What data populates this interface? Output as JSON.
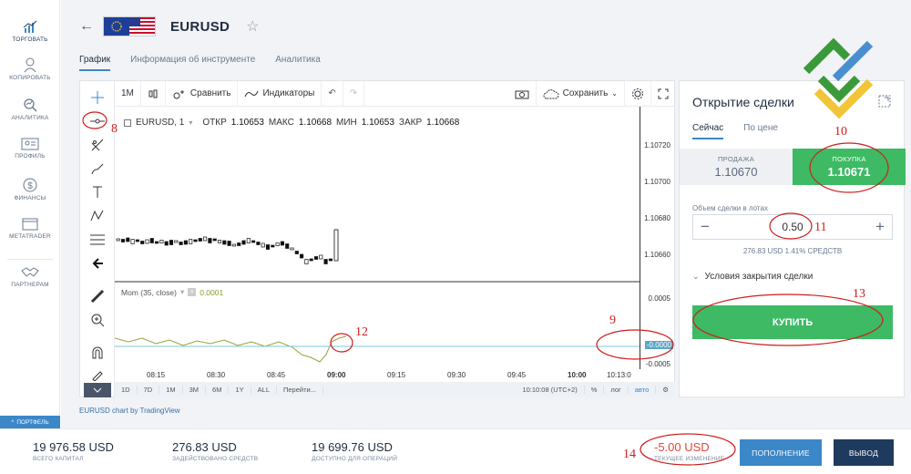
{
  "sidebar": {
    "items": [
      {
        "label": "ТОРГОВАТЬ",
        "icon": "chart-trade-icon"
      },
      {
        "label": "КОПИРОВАТЬ",
        "icon": "copy-user-icon"
      },
      {
        "label": "АНАЛИТИКА",
        "icon": "analytics-icon"
      },
      {
        "label": "ПРОФИЛЬ",
        "icon": "profile-card-icon"
      },
      {
        "label": "ФИНАНСЫ",
        "icon": "dollar-icon"
      },
      {
        "label": "METATRADER",
        "icon": "window-icon"
      },
      {
        "label": "ПАРТНЕРАМ",
        "icon": "handshake-icon"
      }
    ],
    "portfolio_tab": "ПОРТФЕЛЬ"
  },
  "header": {
    "symbol": "EURUSD",
    "tabs": [
      "График",
      "Информация об инструменте",
      "Аналитика"
    ]
  },
  "toolbar": {
    "interval": "1М",
    "compare": "Сравнить",
    "indicators": "Индикаторы",
    "save": "Сохранить"
  },
  "legend": {
    "symbol": "EURUSD, 1",
    "open_label": "ОТКР",
    "open": "1.10653",
    "high_label": "МАКС",
    "high": "1.10668",
    "low_label": "МИН",
    "low": "1.10653",
    "close_label": "ЗАКР",
    "close": "1.10668"
  },
  "price_axis": [
    "1.10720",
    "1.10700",
    "1.10680",
    "1.10660"
  ],
  "mom": {
    "label": "Mom (35, close)",
    "value": "0.0001",
    "axis_top": "0.0005",
    "axis_mid": "-0.0000",
    "axis_bottom": "-0.0005"
  },
  "time_axis": [
    "08:15",
    "08:30",
    "08:45",
    "09:00",
    "09:15",
    "09:30",
    "09:45",
    "10:00",
    "10:13:0"
  ],
  "bottom_bar": {
    "ranges": [
      "1D",
      "7D",
      "1М",
      "3М",
      "6М",
      "1Y",
      "ALL",
      "Перейти..."
    ],
    "clock": "10:10:08 (UTC+2)",
    "percent": "%",
    "log": "лог",
    "auto": "авто"
  },
  "credit": "EURUSD chart by TradingView",
  "order": {
    "title": "Открытие сделки",
    "tabs": [
      "Сейчас",
      "По цене"
    ],
    "sell_label": "ПРОДАЖА",
    "sell_price": "1.10670",
    "buy_label": "ПОКУПКА",
    "buy_price": "1.10671",
    "lot_label": "Объем сделки в лотах",
    "lot_value": "0.50",
    "minus": "−",
    "plus": "+",
    "lot_info": "276.83 USD   1.41% СРЕДСТВ",
    "conditions": "Условия закрытия сделки",
    "buy_button": "КУПИТЬ"
  },
  "footer": {
    "total_capital": {
      "value": "19 976.58 USD",
      "label": "ВСЕГО КАПИТАЛ"
    },
    "used_funds": {
      "value": "276.83 USD",
      "label": "ЗАДЕЙСТВОВАНО СРЕДСТВ"
    },
    "available": {
      "value": "19 699.76 USD",
      "label": "ДОСТУПНО ДЛЯ ОПЕРАЦИЙ"
    },
    "current_change": {
      "value": "-5.00 USD",
      "label": "ТЕКУЩЕЕ ИЗМЕНЕНИЕ"
    },
    "deposit_button": "ПОПОЛНЕНИЕ",
    "withdraw_button": "ВЫВОД"
  },
  "annotations": [
    "8",
    "9",
    "10",
    "11",
    "12",
    "13",
    "14"
  ],
  "colors": {
    "accent": "#3b87c8",
    "buy": "#3dba63",
    "annotation": "#d01c1c",
    "dark": "#1e3a5f"
  }
}
